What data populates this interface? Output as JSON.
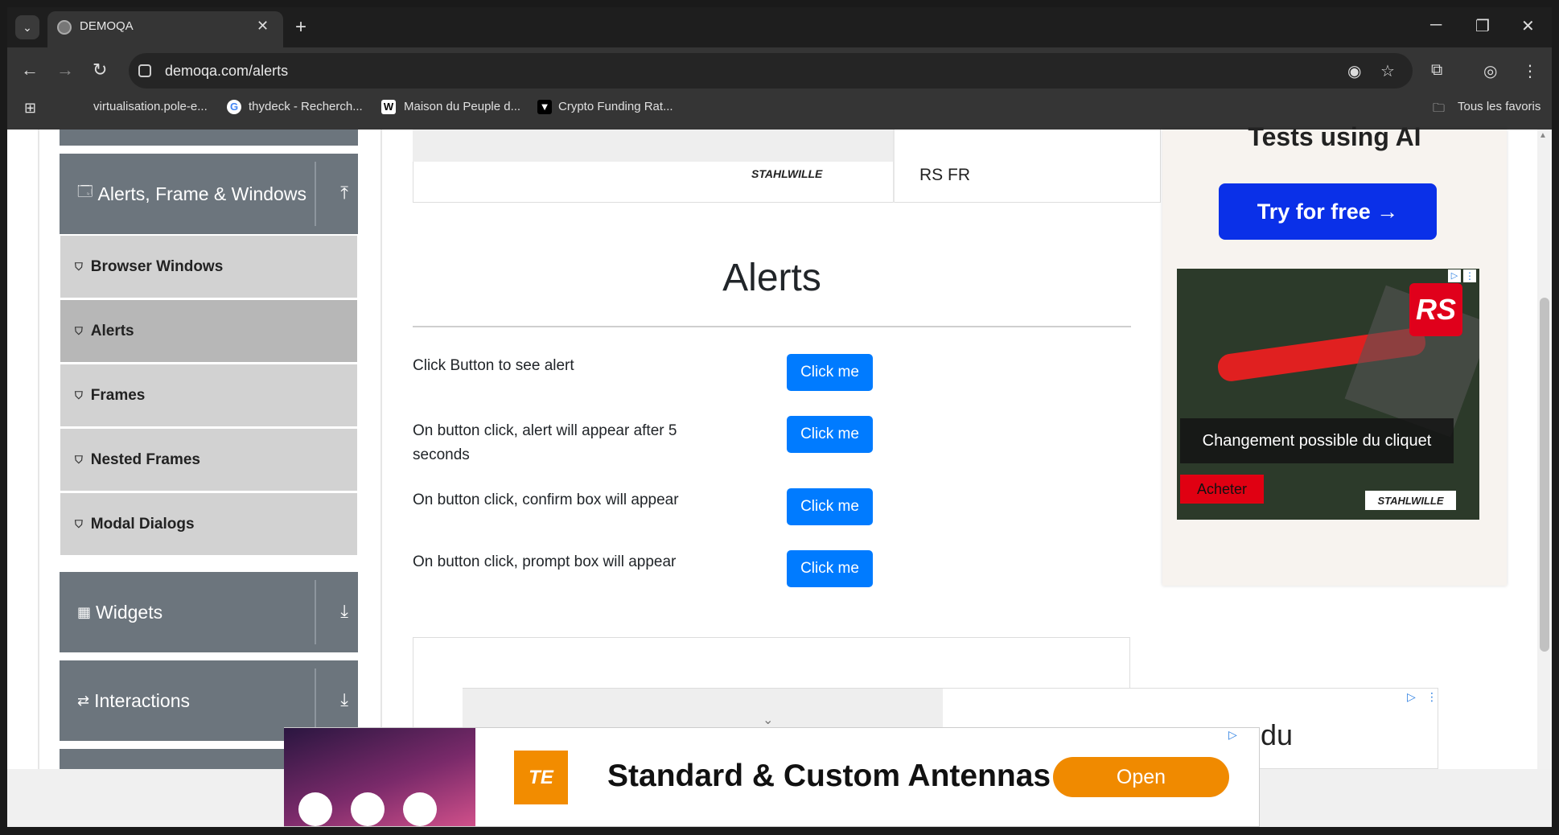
{
  "browser": {
    "tab_title": "DEMOQA",
    "url": "demoqa.com/alerts",
    "bookmarks": [
      {
        "label": "virtualisation.pole-e..."
      },
      {
        "label": "thydeck - Recherch..."
      },
      {
        "label": "Maison du Peuple d..."
      },
      {
        "label": "Crypto Funding Rat..."
      }
    ],
    "all_bookmarks_label": "Tous les favoris"
  },
  "sidebar": {
    "group_header": "Alerts, Frame & Windows",
    "items": [
      {
        "label": "Browser Windows"
      },
      {
        "label": "Alerts"
      },
      {
        "label": "Frames"
      },
      {
        "label": "Nested Frames"
      },
      {
        "label": "Modal Dialogs"
      }
    ],
    "widgets_label": "Widgets",
    "interactions_label": "Interactions"
  },
  "main": {
    "title": "Alerts",
    "rows": [
      {
        "text": "Click Button to see alert",
        "button": "Click me"
      },
      {
        "text": "On button click, alert will appear after 5 seconds",
        "button": "Click me"
      },
      {
        "text": "On button click, confirm box will appear",
        "button": "Click me"
      },
      {
        "text": "On button click, prompt box will appear",
        "button": "Click me"
      }
    ]
  },
  "ads": {
    "top_brand": "STAHLWILLE",
    "top_label": "RS FR",
    "right_heading": "Tests using AI",
    "right_button": "Try for free →",
    "rs_logo": "RS",
    "rs_caption": "Changement possible du cliquet",
    "rs_buy": "Acheter",
    "rs_brand": "STAHLWILLE",
    "bottom_partial_text": "e du",
    "sticky_logo": "TE",
    "sticky_title": "Standard & Custom Antennas",
    "sticky_button": "Open"
  },
  "colors": {
    "primary_button": "#007bff",
    "sidebar_header": "#6c757d",
    "sticky_button": "#f08a00"
  }
}
